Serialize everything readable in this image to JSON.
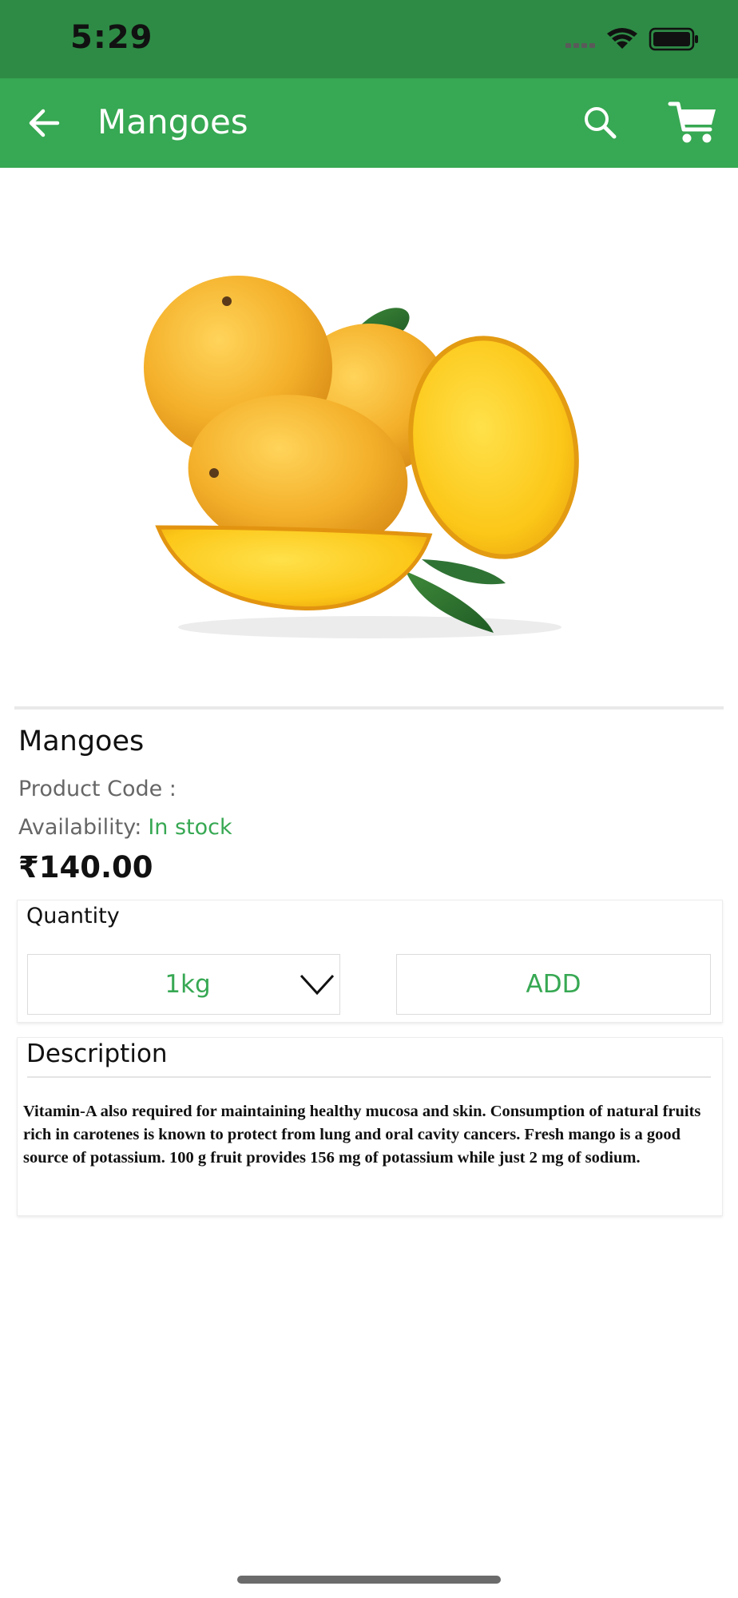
{
  "status_bar": {
    "time": "5:29"
  },
  "app_bar": {
    "title": "Mangoes",
    "icons": [
      "back-arrow-icon",
      "search-icon",
      "cart-icon"
    ]
  },
  "product": {
    "image": "mangoes-photo",
    "name": "Mangoes",
    "code_label": "Product Code :",
    "availability_label": "Availability:",
    "availability_value": "In stock",
    "price": "₹140.00"
  },
  "quantity": {
    "label": "Quantity",
    "selected": "1kg",
    "add_label": "ADD"
  },
  "description": {
    "title": "Description",
    "text": "Vitamin-A also required for maintaining healthy mucosa and skin. Consumption of natural fruits rich in carotenes is known to protect from lung and oral cavity cancers. Fresh mango is a good source of potassium. 100 g fruit provides 156 mg of potassium while just 2 mg of sodium."
  },
  "colors": {
    "status_bar": "#2e8b45",
    "app_bar": "#37a853",
    "accent_green": "#37a853",
    "text": "#111111",
    "muted_text": "#666666"
  }
}
